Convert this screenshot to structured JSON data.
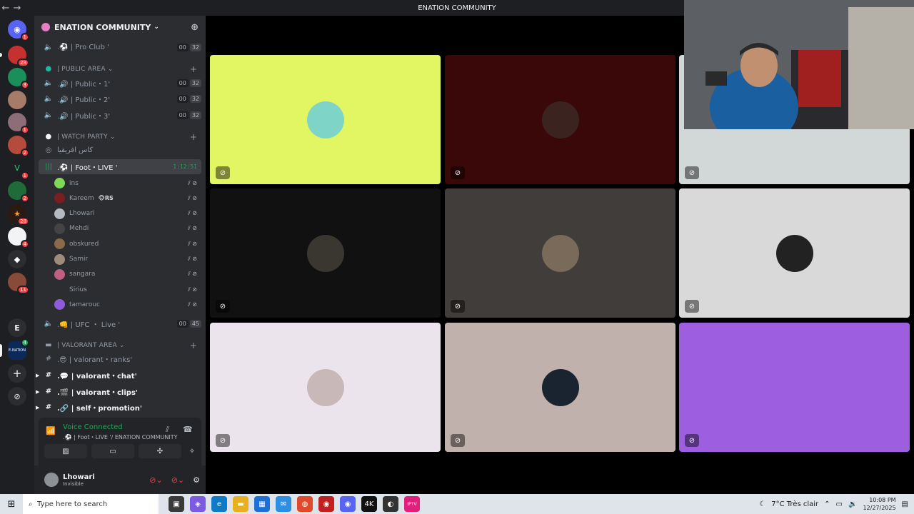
{
  "window": {
    "title": "ENATION COMMUNITY",
    "back": "←",
    "forward": "→"
  },
  "guilds": {
    "badges": [
      "1",
      "28",
      "3",
      "1",
      "1",
      "2",
      "1",
      "2",
      "28",
      "4",
      "11",
      "4"
    ],
    "letter": "E",
    "enation_label": "E-NATION",
    "add": "+",
    "explore": "⊘"
  },
  "server": {
    "name": "ENATION COMMUNITY",
    "chevron": "⌄",
    "invite_icon": "person-add"
  },
  "channels": [
    {
      "label": ".⚽ | Pro Club '",
      "count1": "00",
      "count2": "32"
    },
    {
      "label": "| PUBLIC AREA ⌄",
      "category": true
    },
    {
      "label": ".🔊 | Public・1'",
      "count1": "00",
      "count2": "32"
    },
    {
      "label": ".🔊 | Public・2'",
      "count1": "00",
      "count2": "32"
    },
    {
      "label": ".🔊 | Public・3'",
      "count1": "00",
      "count2": "32"
    },
    {
      "label": "| WATCH PARTY ⌄",
      "category": true
    },
    {
      "label": "كاس افريقيا",
      "stage": true
    },
    {
      "label": ".⚽ | Foot・LIVE '",
      "time": "1:12:51"
    },
    {
      "label": ".👊 | UFC ・ Live '",
      "count1": "00",
      "count2": "45"
    },
    {
      "label": "| VALORANT AREA ⌄",
      "category": true
    },
    {
      "label": ".😎 | valorant・ranks'"
    },
    {
      "label": ".💬 | valorant・chat'"
    },
    {
      "label": ".🎬 | valorant・clips'"
    },
    {
      "label": ".🔗 | self・promotion'"
    }
  ],
  "voice_users": [
    {
      "name": "ins",
      "color": "#7ed957"
    },
    {
      "name": "Kareem",
      "color": "#7a1f1f",
      "tag": "🐵RS"
    },
    {
      "name": "Lhowari",
      "color": "#b5bac1"
    },
    {
      "name": "Mehdi",
      "color": "#444"
    },
    {
      "name": "obskured",
      "color": "#8a6a4a"
    },
    {
      "name": "Samir",
      "color": "#9d8c7a"
    },
    {
      "name": "sangara",
      "color": "#c06080"
    },
    {
      "name": "Sirius",
      "color": "#2b2d31"
    },
    {
      "name": "tamarouc",
      "color": "#8e5cdb"
    }
  ],
  "voice_panel": {
    "status": "Voice Connected",
    "channel": ".⚽ | Foot・LIVE '/ ENATION COMMUNITY"
  },
  "user_panel": {
    "name": "Lhowari",
    "status": "Invisible"
  },
  "tiles": [
    {
      "bg": "#e2f562",
      "av": "#7ed4c6"
    },
    {
      "bg": "#3a0809",
      "av": "#3b2420"
    },
    {
      "bg": "#d2d7d8",
      "av": "#d2d7d8"
    },
    {
      "bg": "#111111",
      "av": "#3a3630"
    },
    {
      "bg": "#403d3a",
      "av": "#7a6a5a"
    },
    {
      "bg": "#d9d9d9",
      "av": "#222222"
    },
    {
      "bg": "#ece4ec",
      "av": "#c8b8b8"
    },
    {
      "bg": "#c1b1ac",
      "av": "#1a2330"
    },
    {
      "bg": "#9d5fe0",
      "av": "#9d5fe0"
    }
  ],
  "taskbar": {
    "search_placeholder": "Type here to search",
    "weather": "7°C  Très clair",
    "time": "10:08 PM",
    "date": "12/27/2025",
    "app_badge": "4K",
    "iptv": "IPTV"
  }
}
